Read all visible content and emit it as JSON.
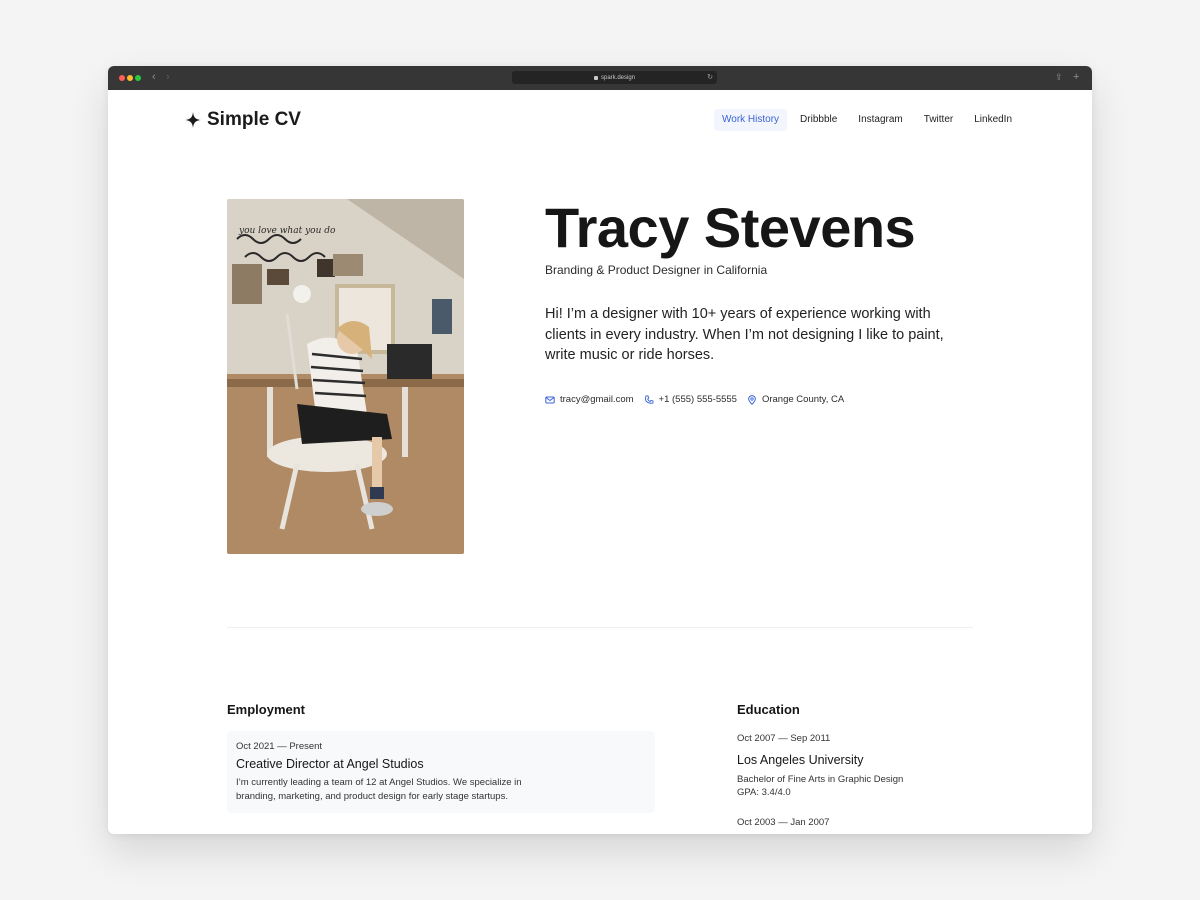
{
  "browser": {
    "url": "spark.design"
  },
  "header": {
    "brand": "Simple CV",
    "nav": [
      "Work History",
      "Dribbble",
      "Instagram",
      "Twitter",
      "LinkedIn"
    ],
    "active_nav": "Work History"
  },
  "hero": {
    "name": "Tracy Stevens",
    "tagline": "Branding & Product Designer in California",
    "bio": "Hi! I’m a designer with 10+ years of experience working with clients in every industry. When I’m not designing I like to paint, write music or ride horses.",
    "email": "tracy@gmail.com",
    "phone": "+1 (555) 555-5555",
    "location": "Orange County, CA",
    "photo_text": "you love what you do"
  },
  "employment": {
    "title": "Employment",
    "jobs": [
      {
        "dates": "Oct 2021 — Present",
        "role": "Creative Director at Angel Studios",
        "description": "I’m currently leading a team of 12 at Angel Studios. We specialize in branding, marketing, and product design for early stage startups."
      }
    ]
  },
  "education": {
    "title": "Education",
    "items": [
      {
        "dates": "Oct 2007 — Sep 2011",
        "school": "Los Angeles University",
        "degree": "Bachelor of Fine Arts in Graphic Design",
        "gpa": "GPA: 3.4/4.0"
      },
      {
        "dates": "Oct 2003 — Jan 2007"
      }
    ]
  },
  "colors": {
    "accent": "#3b63d6",
    "titlebar": "#363636",
    "text": "#1b1b1b"
  }
}
